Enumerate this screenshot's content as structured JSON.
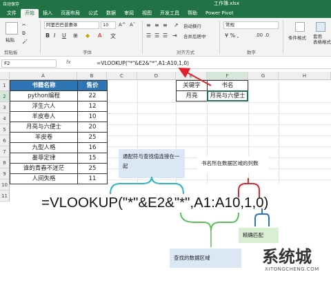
{
  "titlebar": {
    "autosave": "自动保存",
    "filename": "工作簿.xlsx"
  },
  "tabs": [
    "文件",
    "开始",
    "插入",
    "页面布局",
    "公式",
    "数据",
    "审阅",
    "视图",
    "开发工具",
    "帮助",
    "Power Pivot"
  ],
  "ribbon": {
    "paste": "粘贴",
    "clipboard": "剪贴板",
    "font_name": "阿里巴巴普惠体",
    "font_size": "10",
    "font_group": "字体",
    "wrap": "自动换行",
    "merge": "合并后居中",
    "align_group": "对齐方式",
    "number_format": "常规",
    "number_group": "数字",
    "cond_format": "条件格式",
    "table_format": "套用\n表格格式"
  },
  "formula_bar": {
    "name_box": "F2",
    "fx": "fx",
    "formula": "=VLOOKUP(\"*\"&E2&\"*\",A1:A10,1,0)"
  },
  "columns": [
    "A",
    "B",
    "C",
    "D",
    "E",
    "F",
    "G",
    "H"
  ],
  "rows": [
    "1",
    "2",
    "3",
    "4",
    "5",
    "6",
    "7",
    "8",
    "9",
    "10",
    "11"
  ],
  "table": {
    "headers": [
      "书籍名称",
      "售价"
    ],
    "rows": [
      [
        "python编程",
        "22"
      ],
      [
        "浮生六人",
        "12"
      ],
      [
        "羊皮卷人",
        "10"
      ],
      [
        "月亮与六便士",
        "20"
      ],
      [
        "羊皮卷",
        "25"
      ],
      [
        "九型人格",
        "16"
      ],
      [
        "墨菲定律",
        "15"
      ],
      [
        "谁的青春不迷茫",
        "25"
      ],
      [
        "人间失格",
        "11"
      ]
    ]
  },
  "lookup": {
    "header_key": "关键字",
    "header_name": "书名",
    "key": "月亮",
    "result": "月亮与六便士"
  },
  "annotation": {
    "big_formula": "=VLOOKUP(\"*\"&E2&\"*\",A1:A10,1,0)",
    "note_concat": "通配符与查找值连接在一起",
    "note_column": "书名所在数据区域的列数",
    "note_exact": "精确匹配",
    "note_range": "查找的数据区域"
  },
  "watermark": {
    "text": "系统城",
    "sub": "XITONGCHENG.COM"
  },
  "colors": {
    "excel_green": "#217346",
    "header_blue": "#2e75b6",
    "arrow_red": "#e0202a",
    "bracket_cyan": "#2bb5c9",
    "bracket_red": "#d9252f",
    "bracket_blue": "#2f6fd0",
    "bracket_green": "#5cbf5a"
  }
}
